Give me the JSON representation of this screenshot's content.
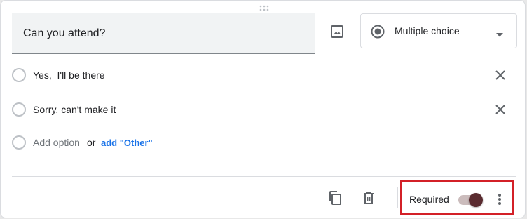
{
  "question": {
    "title": "Can you attend?",
    "type_label": "Multiple choice"
  },
  "options": [
    {
      "label": "Yes,  I'll be there"
    },
    {
      "label": "Sorry, can't make it"
    }
  ],
  "add_option": {
    "label": "Add option",
    "or_text": "or",
    "other_link": "add \"Other\""
  },
  "footer": {
    "required_label": "Required",
    "required_on": true
  },
  "icons": {
    "drag": "drag-handle-icon",
    "image": "image-icon",
    "type": "radio-button-checked-icon",
    "dropdown": "arrow-drop-down-icon",
    "remove": "close-icon",
    "duplicate": "copy-icon",
    "delete": "trash-icon",
    "more": "more-vert-icon"
  },
  "colors": {
    "accent_link": "#1a73e8",
    "highlight": "#d32027",
    "toggle_thumb": "#5a2b2f",
    "toggle_track": "#cbbcbc"
  }
}
